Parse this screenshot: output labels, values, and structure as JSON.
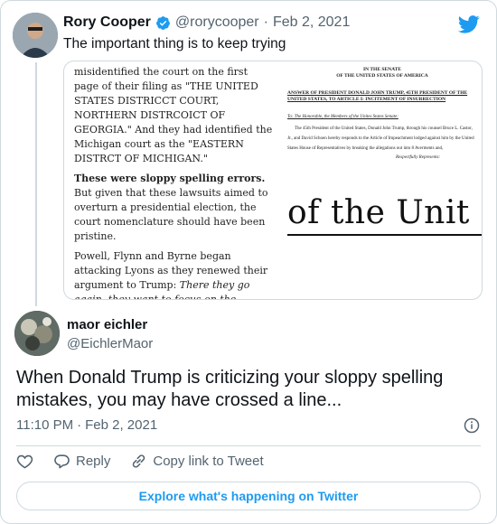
{
  "parent": {
    "name": "Rory Cooper",
    "handle": "@rorycooper",
    "dot": "·",
    "date": "Feb 2, 2021",
    "text": "The important thing is to keep trying"
  },
  "media": {
    "left_paragraphs": [
      "misidentified the court on the first page of their filing as \"THE UNITED STATES DISTRICCT COURT, NORTHERN DISTRCOICT OF GEORGIA.\" And they had identified the Michigan court as the \"EASTERN DISTRCT OF MICHIGAN.\"",
      "given that these lawsuits aimed to overturn a presidential election, the court nomenclature should have been pristine.",
      "Powell, Flynn and Byrne began attacking Lyons as they renewed their argument to Trump: "
    ],
    "bold_lead": "These were sloppy spelling errors.",
    "bold_lead_rest": " But",
    "italic_tail": "There they go again, they want to focus on the insignificant details instead of fighting for you.",
    "right_head_1": "IN THE SENATE",
    "right_head_2": "OF THE UNITED STATES OF AMERICA",
    "right_title": "ANSWER OF PRESIDENT DONALD JOHN TRUMP, 45TH PRESIDENT OF THE UNITED STATES, TO ARTICLE I: INCITEMENT OF INSURRECTION",
    "right_to": "To: The Honorable, the Members of the Unites States Senate:",
    "right_body": "The 45th President of the United States, Donald John Trump, through his counsel Bruce L. Castor, Jr., and David Schoen hereby responds to the Article of Impeachment lodged against him by the United States House of Representatives by breaking the allegations out into 8 Averments and,",
    "right_resp": "Respectfully Represents:",
    "right_big": "of the Unit"
  },
  "reply": {
    "name": "maor eichler",
    "handle": "@EichlerMaor",
    "text": "When Donald Trump is criticizing your sloppy spelling mistakes, you may have crossed a line...",
    "time": "11:10 PM",
    "dot": "·",
    "date": "Feb 2, 2021"
  },
  "actions": {
    "reply_label": "Reply",
    "copy_label": "Copy link to Tweet"
  },
  "explore_label": "Explore what's happening on Twitter",
  "colors": {
    "accent": "#1d9bf0",
    "secondary_text": "#536471",
    "border": "#cfd9de"
  },
  "icons": [
    "verified-badge-icon",
    "twitter-bird-icon",
    "info-icon",
    "heart-icon",
    "reply-icon",
    "link-icon"
  ]
}
